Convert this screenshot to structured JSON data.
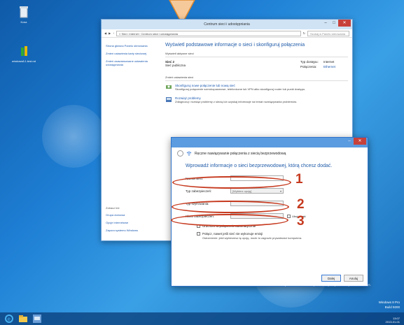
{
  "desktop": {
    "icons": [
      {
        "label": "Kosz"
      },
      {
        "label": "windows8.1.test.nd"
      }
    ]
  },
  "control_panel": {
    "window_title": "Centrum sieci i udostępniania",
    "address": "« Sieć i Internet › Centrum sieci i udostępniania",
    "search_placeholder": "Szukaj w Panelu sterowania",
    "left_links": [
      "Strona główna Panelu sterowania",
      "Zmień ustawienia karty sieciowej",
      "Zmień zaawansowane ustawienia udostępniania"
    ],
    "see_also_heading": "Zobacz też",
    "see_also": [
      "Grupa domowa",
      "Opcje internetowe",
      "Zapora systemu Windows"
    ],
    "heading": "Wyświetl podstawowe informacje o sieci i skonfiguruj połączenia",
    "active_networks_label": "Wyświetl aktywne sieci",
    "network_name": "Sieć 2",
    "network_type": "Sieć publiczna",
    "access_type_label": "Typ dostępu:",
    "access_type_value": "Internet",
    "connections_label": "Połączenia:",
    "connections_value": "Ethernet",
    "change_settings_label": "Zmień ustawienia sieci",
    "tasks": [
      {
        "title": "Skonfiguruj nowe połączenie lub nową sieć",
        "desc": "Skonfiguruj połączenie szerokopasmowe, telefoniczne lub VPN albo skonfiguruj router lub punkt dostępu."
      },
      {
        "title": "Rozwiąż problemy",
        "desc": "Zdiagnozuj i rozwiąż problemy z siecią lub uzyskaj informacje na temat rozwiązywania problemów."
      }
    ]
  },
  "wireless_dialog": {
    "title": "Ręczne nawiązywanie połączenia z siecią bezprzewodową",
    "heading": "Wprowadź informacje o sieci bezprzewodowej, którą chcesz dodać.",
    "fields": {
      "network_name_label": "Nazwa sieci:",
      "security_type_label": "Typ zabezpieczeń:",
      "security_type_value": "[Wybierz opcję]",
      "encryption_type_label": "Typ szyfrowania:",
      "security_key_label": "Klucz zabezpieczeń:",
      "hide_chars_label": "Ukryj znaki"
    },
    "checkboxes": [
      {
        "label": "Uruchom to połączenie automatycznie",
        "note": ""
      },
      {
        "label": "Połącz, nawet jeśli sieć nie wykonuje emisji",
        "note": "Ostrzeżenie: jeśli wybierzesz tę opcję, może to zagrozić prywatności komputera."
      }
    ],
    "next_button": "Dalej",
    "cancel_button": "Anuluj"
  },
  "callouts": [
    "1",
    "2",
    "3"
  ],
  "watermark": {
    "line1": "Windows 8 Pro",
    "line2": "Build 9200"
  },
  "activate_text": "Aktywuj system Windows\nPrzejdź do ustawień komputera, aby aktywować system Windows.",
  "tray": {
    "time": "13:07",
    "date": "2013-01-01"
  }
}
